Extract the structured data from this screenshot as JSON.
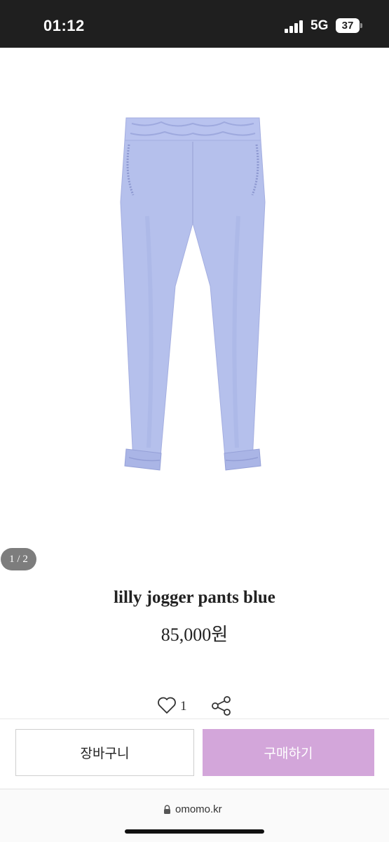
{
  "status_bar": {
    "time": "01:12",
    "network": "5G",
    "battery_level": "37",
    "icons": [
      "signal-bars-icon",
      "battery-icon"
    ]
  },
  "product": {
    "image_icon": "jogger-pants-photo",
    "image_color": "#b5c0ec",
    "image_counter": "1 / 2",
    "title": "lilly jogger pants blue",
    "price": "85,000원",
    "like_count": "1",
    "icons": [
      "heart-icon",
      "share-icon"
    ]
  },
  "actions": {
    "cart_label": "장바구니",
    "buy_label": "구매하기",
    "accent_color": "#d3a6da"
  },
  "browser": {
    "url": "omomo.kr",
    "icons": [
      "lock-icon"
    ]
  }
}
